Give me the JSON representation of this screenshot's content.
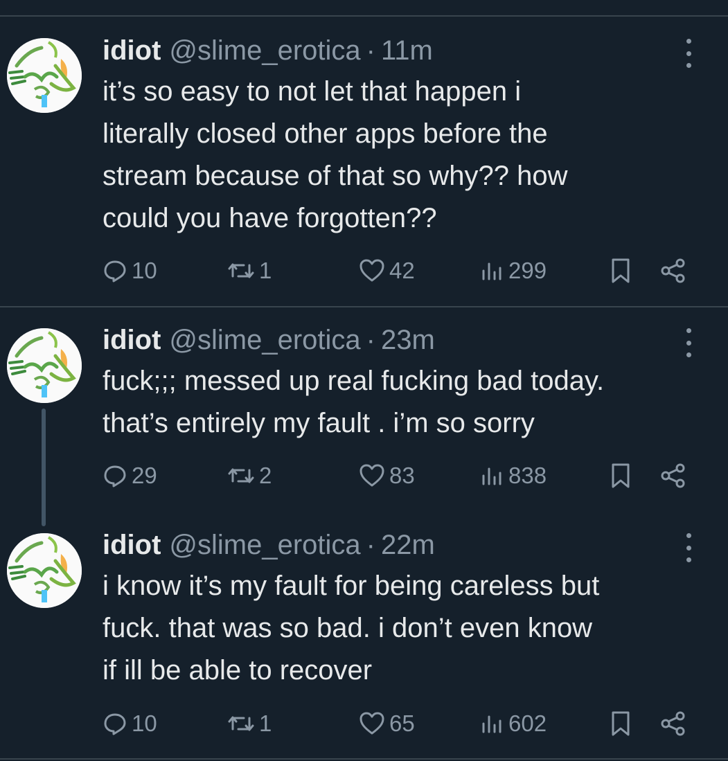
{
  "tweets": [
    {
      "name": "idiot",
      "handle": "@slime_erotica",
      "separator": "·",
      "time": "11m",
      "text_lines": [
        "it’s so easy to not let that happen i",
        "literally closed other apps before the",
        "stream because of that so why?? how",
        "could you have forgotten??"
      ],
      "replies": "10",
      "reposts": "1",
      "likes": "42",
      "views": "299"
    },
    {
      "name": "idiot",
      "handle": "@slime_erotica",
      "separator": "·",
      "time": "23m",
      "text_lines": [
        "fuck;;; messed up real fucking bad today.",
        "that’s entirely my fault . i’m so sorry"
      ],
      "replies": "29",
      "reposts": "2",
      "likes": "83",
      "views": "838"
    },
    {
      "name": "idiot",
      "handle": "@slime_erotica",
      "separator": "·",
      "time": "22m",
      "text_lines": [
        "i know it’s my fault for being careless but",
        "fuck. that was so bad. i don’t even know",
        "if ill be able to recover"
      ],
      "replies": "10",
      "reposts": "1",
      "likes": "65",
      "views": "602"
    }
  ],
  "icons": {
    "reply": "reply-icon",
    "repost": "repost-icon",
    "like": "heart-icon",
    "views": "views-icon",
    "bookmark": "bookmark-icon",
    "share": "share-icon",
    "more": "more-icon"
  },
  "colors": {
    "background": "#15202b",
    "text": "#e7e9ea",
    "secondary": "#8b98a5",
    "divider": "#38444d",
    "thread_line": "#425566"
  }
}
